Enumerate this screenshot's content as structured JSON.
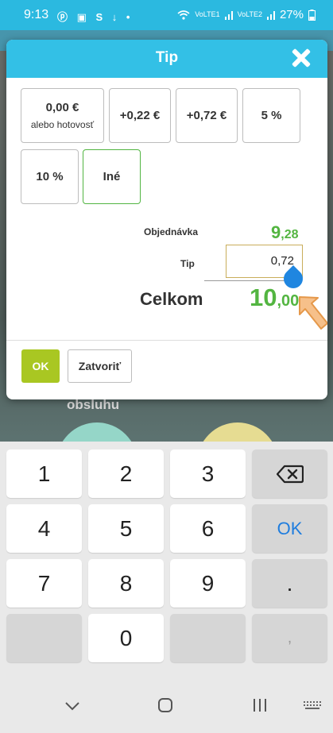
{
  "status_bar": {
    "time": "9:13",
    "left_icons": "ⓟ ▣ S ↓ •",
    "network_label_1": "VoLTE1",
    "network_label_2": "VoLTE2",
    "battery": "27%"
  },
  "background": {
    "partial_text": "obsluhu"
  },
  "dialog": {
    "title": "Tip",
    "options": [
      {
        "label": "0,00 €",
        "sub": "alebo hotovosť",
        "selected": false
      },
      {
        "label": "+0,22 €",
        "selected": false
      },
      {
        "label": "+0,72 €",
        "selected": false
      },
      {
        "label": "5 %",
        "selected": false
      },
      {
        "label": "10 %",
        "selected": false
      },
      {
        "label": "Iné",
        "selected": true
      }
    ],
    "order_label": "Objednávka",
    "order_value_int": "9",
    "order_value_dec": ",28",
    "tip_label": "Tip",
    "tip_value": "0,72",
    "total_label": "Celkom",
    "total_value_int": "10",
    "total_value_dec": ",00",
    "ok_label": "OK",
    "close_label": "Zatvoriť"
  },
  "keyboard": {
    "row1": [
      "1",
      "2",
      "3"
    ],
    "row2": [
      "4",
      "5",
      "6"
    ],
    "row3": [
      "7",
      "8",
      "9"
    ],
    "zero": "0",
    "ok": "OK",
    "dot": ".",
    "comma": ","
  },
  "colors": {
    "accent": "#33c0e6",
    "status_bar": "#2bb9e0",
    "green": "#53b541",
    "ok_button": "#a9c722",
    "keyboard_ok": "#1f7dde"
  }
}
